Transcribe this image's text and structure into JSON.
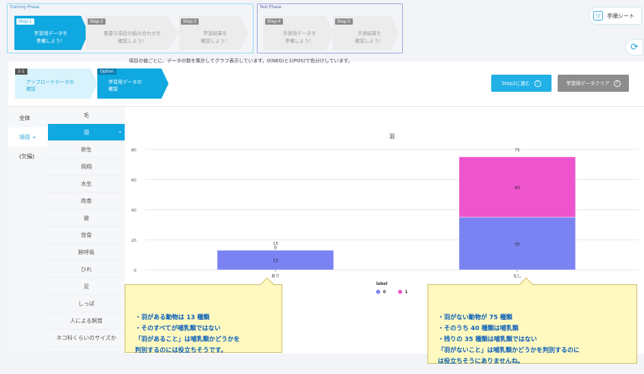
{
  "training_phase": {
    "title": "Training Phase",
    "steps": [
      {
        "tag": "Step:1",
        "text": "学習用データを\n準備しよう！"
      },
      {
        "tag": "Step:2",
        "text": "重要な項目の組み合わせを\n確認しよう！"
      },
      {
        "tag": "Step:3",
        "text": "学習結果を\n確認しよう！"
      }
    ]
  },
  "test_phase": {
    "title": "Test Phase",
    "steps": [
      {
        "tag": "Step:4",
        "text": "予測用データを\n準備しよう！"
      },
      {
        "tag": "Step:5",
        "text": "予測結果を\n確認しよう！"
      }
    ]
  },
  "manual": {
    "label": "手順シート",
    "icon": "face-sheet-icon"
  },
  "refresh": {
    "icon": "refresh-icon",
    "glyph": "⟳"
  },
  "substeps": [
    {
      "tag": "1-1",
      "text": "アップロードデータの\n確認"
    },
    {
      "tag": "Option",
      "text": "学習用データの\n確認"
    }
  ],
  "buttons": {
    "step2": "Step2に進む",
    "clear": "学習用データクリア",
    "help_glyph": "?"
  },
  "nav": {
    "items": [
      {
        "label": "全体"
      },
      {
        "label": "項目",
        "arrow": "▸"
      },
      {
        "label": "(欠損)"
      }
    ]
  },
  "features": [
    "毛",
    "羽",
    "卵生",
    "飛翔",
    "水生",
    "肉食",
    "歯",
    "背骨",
    "肺呼吸",
    "ひれ",
    "足",
    "しっぽ",
    "人による飼育",
    "ネコ科くらいのサイズか"
  ],
  "feature_arrow": "▸",
  "description": "項目の値ごとに、データの数を集計してグラフ表示しています。0(NEG)と1(POS)で色分けしています。",
  "chart_data": {
    "type": "bar",
    "stacked": true,
    "title": "羽",
    "categories": [
      "あり",
      "なし"
    ],
    "series": [
      {
        "name": "0",
        "values": [
          13,
          35
        ],
        "color": "#7b83f2"
      },
      {
        "name": "1",
        "values": [
          0,
          40
        ],
        "color": "#ee55cc"
      }
    ],
    "totals": [
      13,
      75
    ],
    "ylim": [
      0,
      80
    ],
    "yticks": [
      0,
      20,
      40,
      60,
      80
    ],
    "legend_title": "label",
    "legend_position": "bottom"
  },
  "callouts": {
    "left": "・羽がある動物は 13 種類\n・そのすべてが哺乳類ではない\n「羽があること」は哺乳類かどうかを\n判別するのには役立ちそうです。",
    "right": "・羽がない動物が 75 種類\n・そのうち 40 種類は哺乳類\n・残りの 35 種類は哺乳類ではない\n「羽がないこと」は哺乳類かどうかを判別するのに\nは役立ちそうにありませんね。"
  }
}
